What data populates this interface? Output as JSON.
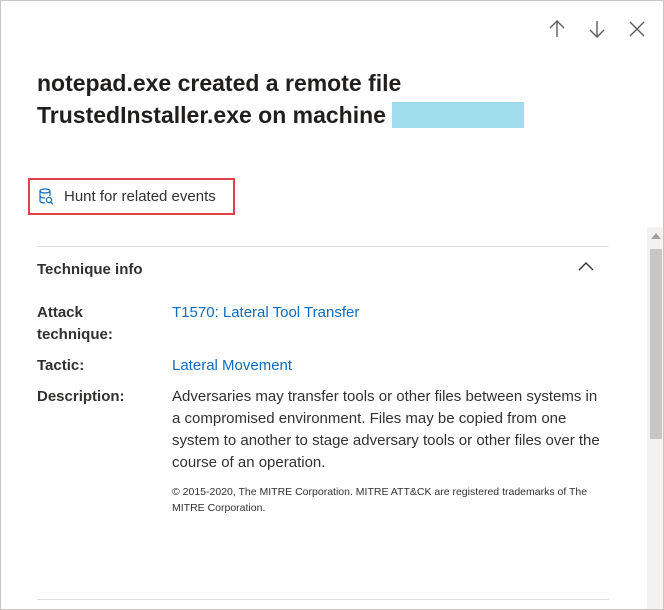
{
  "header": {
    "icons": [
      "arrow-up-icon",
      "arrow-down-icon",
      "close-icon"
    ]
  },
  "title": {
    "line1": "notepad.exe created a remote file",
    "line2": "TrustedInstaller.exe on machine"
  },
  "hunt": {
    "label": "Hunt for related events",
    "icon": "database-search-icon",
    "highlight_color": "#e0404a"
  },
  "technique": {
    "section_title": "Technique info",
    "attack_label_line1": "Attack",
    "attack_label_line2": "technique:",
    "attack_value": "T1570: Lateral Tool Transfer",
    "tactic_label": "Tactic:",
    "tactic_value": "Lateral Movement",
    "description_label": "Description:",
    "description_value": "Adversaries may transfer tools or other files between systems in a compromised environment. Files may be copied from one system to another to stage adversary tools or other files over the course of an operation.",
    "copyright": "© 2015-2020, The MITRE Corporation. MITRE ATT&CK are registered trademarks of The MITRE Corporation."
  },
  "colors": {
    "link": "#0f6cbd",
    "redaction": "#9fdcec"
  }
}
